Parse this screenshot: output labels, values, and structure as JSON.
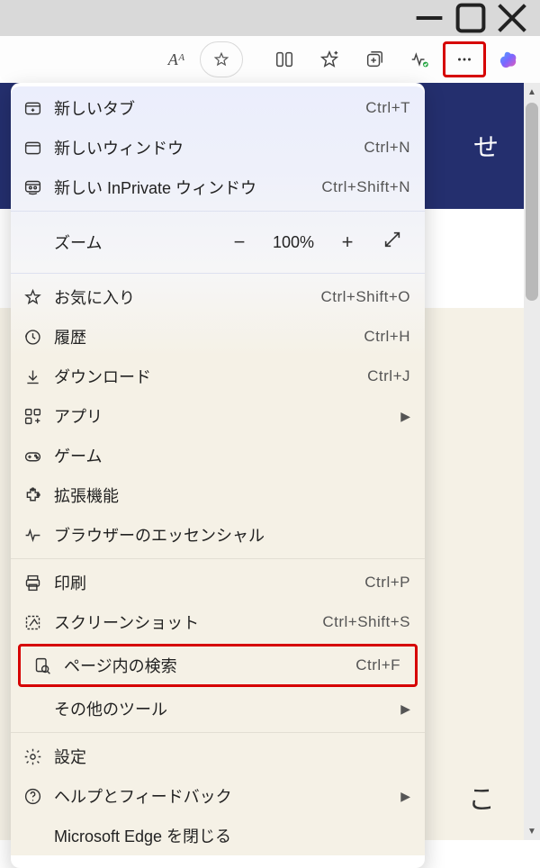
{
  "window": {
    "minimize": "—",
    "maximize": "❐",
    "close": "✕"
  },
  "toolbar": {
    "readaloud": "Aᴬ",
    "fav_star": "☆"
  },
  "page": {
    "blue_text": "せ",
    "corner_letter": "こ"
  },
  "menu": {
    "new_tab": {
      "label": "新しいタブ",
      "shortcut": "Ctrl+T"
    },
    "new_window": {
      "label": "新しいウィンドウ",
      "shortcut": "Ctrl+N"
    },
    "new_inprivate": {
      "label": "新しい InPrivate ウィンドウ",
      "shortcut": "Ctrl+Shift+N"
    },
    "zoom": {
      "label": "ズーム",
      "minus": "−",
      "value": "100%",
      "plus": "+"
    },
    "favorites": {
      "label": "お気に入り",
      "shortcut": "Ctrl+Shift+O"
    },
    "history": {
      "label": "履歴",
      "shortcut": "Ctrl+H"
    },
    "downloads": {
      "label": "ダウンロード",
      "shortcut": "Ctrl+J"
    },
    "apps": {
      "label": "アプリ"
    },
    "games": {
      "label": "ゲーム"
    },
    "extensions": {
      "label": "拡張機能"
    },
    "essentials": {
      "label": "ブラウザーのエッセンシャル"
    },
    "print": {
      "label": "印刷",
      "shortcut": "Ctrl+P"
    },
    "screenshot": {
      "label": "スクリーンショット",
      "shortcut": "Ctrl+Shift+S"
    },
    "find": {
      "label": "ページ内の検索",
      "shortcut": "Ctrl+F"
    },
    "more_tools": {
      "label": "その他のツール"
    },
    "settings": {
      "label": "設定"
    },
    "help": {
      "label": "ヘルプとフィードバック"
    },
    "close_edge": {
      "label": "Microsoft Edge を閉じる"
    }
  }
}
